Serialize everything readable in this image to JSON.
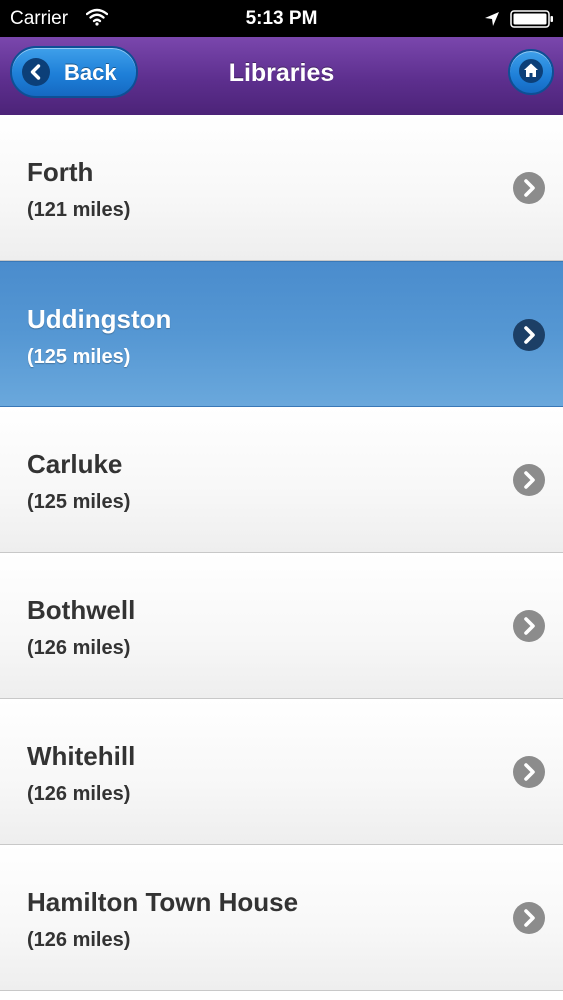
{
  "status_bar": {
    "carrier": "Carrier",
    "time": "5:13 PM"
  },
  "nav": {
    "back_label": "Back",
    "title": "Libraries"
  },
  "libraries": [
    {
      "name": "Forth",
      "distance": "(121 miles)",
      "selected": false
    },
    {
      "name": "Uddingston",
      "distance": "(125 miles)",
      "selected": true
    },
    {
      "name": "Carluke",
      "distance": "(125 miles)",
      "selected": false
    },
    {
      "name": "Bothwell",
      "distance": "(126 miles)",
      "selected": false
    },
    {
      "name": "Whitehill",
      "distance": "(126 miles)",
      "selected": false
    },
    {
      "name": "Hamilton Town House",
      "distance": "(126 miles)",
      "selected": false
    }
  ],
  "colors": {
    "nav_bar": "#5d2f8e",
    "button_blue": "#1e7fd8",
    "selected_row": "#5597d3",
    "text": "#333333"
  },
  "icons": [
    "wifi-icon",
    "location-icon",
    "battery-icon",
    "back-chevron-icon",
    "home-icon",
    "chevron-right-icon"
  ]
}
